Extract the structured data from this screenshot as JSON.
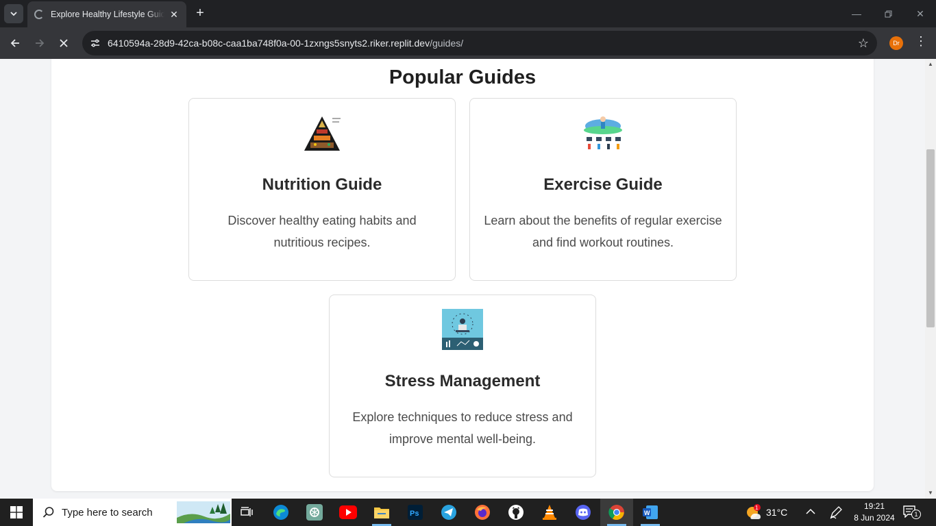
{
  "browser": {
    "tab_title": "Explore Healthy Lifestyle Guides",
    "url_host": "6410594a-28d9-42ca-b08c-caa1ba748f0a-00-1zxngs5snyts2.riker.replit.dev",
    "url_path": "/guides/",
    "profile_initials": "Dr"
  },
  "page": {
    "section_title": "Popular Guides",
    "guides": [
      {
        "title": "Nutrition Guide",
        "description": "Discover healthy eating habits and nutritious recipes.",
        "image": "food-pyramid-image"
      },
      {
        "title": "Exercise Guide",
        "description": "Learn about the benefits of regular exercise and find workout routines.",
        "image": "exercise-illustration-image"
      },
      {
        "title": "Stress Management",
        "description": "Explore techniques to reduce stress and improve mental well-being.",
        "image": "stress-illustration-image"
      }
    ]
  },
  "taskbar": {
    "search_placeholder": "Type here to search",
    "weather": "31°C",
    "time": "19:21",
    "date": "8 Jun 2024",
    "notification_count": "1",
    "weather_badge": "1",
    "apps": [
      "task-view",
      "edge",
      "chatgpt",
      "youtube",
      "file-explorer",
      "photoshop",
      "telegram",
      "firefox",
      "github",
      "vlc",
      "discord",
      "chrome",
      "word"
    ]
  },
  "colors": {
    "chrome_dark": "#202124",
    "toolbar": "#35363a",
    "page_bg": "#f3f4f6",
    "card_border": "#dcdcdc",
    "taskbar": "#202020"
  }
}
